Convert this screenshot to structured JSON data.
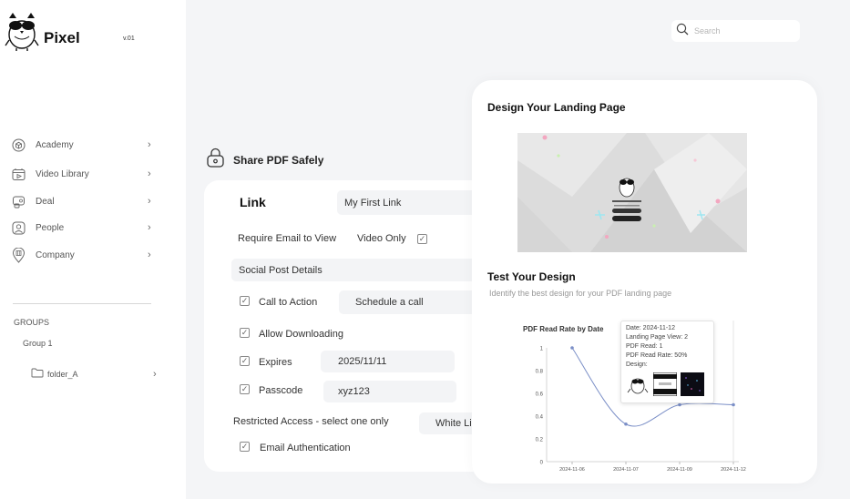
{
  "sidebar": {
    "brand": "Pixel",
    "version": "v.01",
    "items": [
      {
        "label": "Academy",
        "icon": "box-icon"
      },
      {
        "label": "Video Library",
        "icon": "video-icon"
      },
      {
        "label": "Deal",
        "icon": "deal-icon"
      },
      {
        "label": "People",
        "icon": "person-icon"
      },
      {
        "label": "Company",
        "icon": "company-icon"
      }
    ],
    "groups_title": "GROUPS",
    "group_name": "Group 1",
    "folder": "folder_A"
  },
  "search": {
    "placeholder": "Search"
  },
  "share": {
    "title": "Share PDF Safely",
    "link_title": "Link",
    "link_name": "My First Link",
    "require_email": "Require Email to View",
    "video_only": "Video Only",
    "social_post": "Social Post Details",
    "cta_label": "Call to Action",
    "cta_value": "Schedule a  call",
    "allow_downloading": "Allow Downloading",
    "expires_label": "Expires",
    "expires_value": "2025/11/11",
    "passcode_label": "Passcode",
    "passcode_value": "xyz123",
    "restricted_label": "Restricted Access - select one  only",
    "restricted_value": "White Li",
    "email_auth": "Email Authentication"
  },
  "design": {
    "title": "Design Your Landing Page",
    "test_title": "Test Your Design",
    "test_subtitle": "Identify the best design for your PDF landing page"
  },
  "colors": {
    "accent": "#7b8fc7",
    "panel": "#ffffff",
    "bg": "#f4f5f7"
  },
  "chart_data": {
    "type": "line",
    "title": "PDF Read Rate by Date",
    "x": [
      "2024-11-06",
      "2024-11-07",
      "2024-11-09",
      "2024-11-12"
    ],
    "series": [
      {
        "values": [
          1,
          0.33,
          0.5,
          0.5
        ]
      }
    ],
    "yticks": [
      "0",
      "0.2",
      "0.4",
      "0.6",
      "0.8",
      "1"
    ],
    "ylim": [
      0,
      1
    ],
    "grid": false,
    "tooltip": {
      "date": "Date: 2024-11-12",
      "views": "Landing Page View: 2",
      "reads": "PDF Read: 1",
      "rate": "PDF Read Rate: 50%",
      "design": "Design:"
    }
  }
}
